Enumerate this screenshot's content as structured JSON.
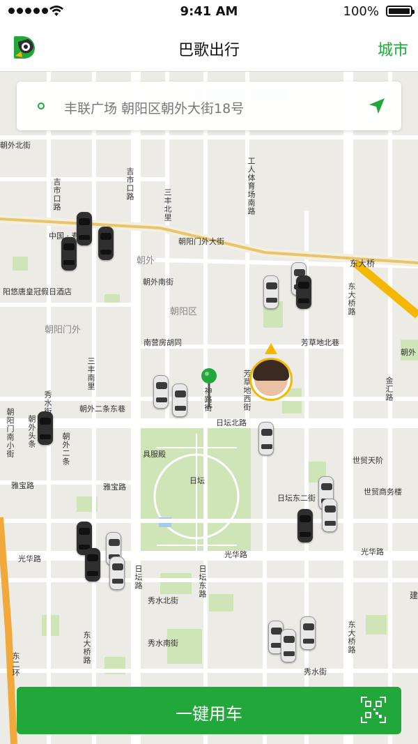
{
  "status_bar": {
    "time": "9:41 AM",
    "battery": "100%"
  },
  "nav": {
    "title": "巴歌出行",
    "city_label": "城市"
  },
  "search": {
    "address": "丰联广场 朝阳区朝外大街18号"
  },
  "map": {
    "labels": {
      "chaoyangmen_outer": "朝阳门外大街",
      "dongdaqiao": "东大桥",
      "chaowai": "朝外",
      "chaowai_nanjie": "朝外南街",
      "chaoyangqu": "朝阳区",
      "chaoyangmenwai": "朝阳门外",
      "nanyingfang": "南营房胡同",
      "fangcaodi": "芳草地北巷",
      "ritan_beilu": "日坛北路",
      "jufudian": "具服殿",
      "ritan": "日坛",
      "ritan_dong2": "日坛东二街",
      "guanghua_w": "光华路",
      "guanghua_m": "光华路",
      "guanghua_e": "光华路",
      "yabao_w": "雅宝路",
      "yabao_e": "雅宝路",
      "xiushui_n": "秀水北街",
      "xiushui_s": "秀水南街",
      "xiushui": "秀水街",
      "shimao_tianjie": "世贸天阶",
      "shimao_center": "世贸商务楼",
      "chaowai_2tiao": "朝外二条东巷",
      "youtang": "阳悠唐皇冠假日酒店",
      "chaowai_right": "朝外",
      "zhongguo": "中国 · 寿",
      "dongdaqiao_lu": "东大桥路",
      "dongdaqiao_lu_s": "东大桥路",
      "gongti_nanlu": "工人体育场南路",
      "jishikou": "吉市口路",
      "jishikou2": "吉市口路",
      "sanfengbei": "三丰北里",
      "chaowai_bei": "朝外北街",
      "jinhui": "金汇路",
      "dong2huan": "东二环",
      "fangcaodi_xijie": "芳草地西街",
      "shenlu": "神路街",
      "ritan_lu": "日坛路",
      "chaoyangmen_nanxiao": "朝阳门南小街",
      "chaowai_toutiao": "朝外头条",
      "chaowai_ertiao": "朝外二条",
      "sanfengnan": "三丰南里",
      "xiushui_ti": "秀水街",
      "ritan_dong": "日坛东路",
      "dongdaqiao_r": "东大桥路",
      "jianguo": "建"
    }
  },
  "call": {
    "label": "一键用车"
  },
  "colors": {
    "accent": "#22a83a",
    "avatar_ring": "#f5b800",
    "road_major": "#e9c46a"
  }
}
